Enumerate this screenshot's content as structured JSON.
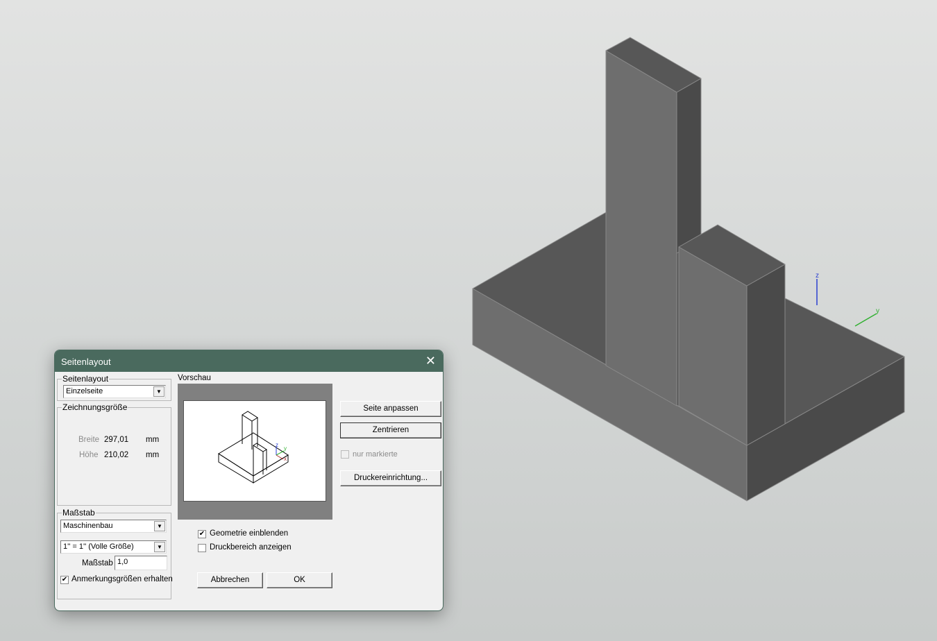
{
  "dialog": {
    "title": "Seitenlayout",
    "layout_group": {
      "label": "Seitenlayout",
      "selected": "Einzelseite"
    },
    "size_group": {
      "label": "Zeichnungsgröße",
      "width_label": "Breite",
      "width_value": "297,01",
      "height_label": "Höhe",
      "height_value": "210,02",
      "unit": "mm"
    },
    "scale_group": {
      "label": "Maßstab",
      "standard": "Maschinenbau",
      "ratio": "1'' = 1'' (Volle Größe)",
      "scale_label": "Maßstab",
      "scale_value": "1,0",
      "keep_annotation_label": "Anmerkungsgrößen erhalten",
      "keep_annotation_checked": true
    },
    "preview": {
      "label": "Vorschau"
    },
    "buttons": {
      "fit": "Seite anpassen",
      "center": "Zentrieren",
      "printer_setup": "Druckereinrichtung...",
      "cancel": "Abbrechen",
      "ok": "OK"
    },
    "only_selected": {
      "label": "nur markierte",
      "checked": false
    },
    "show_geometry": {
      "label": "Geometrie einblenden",
      "checked": true
    },
    "show_print_area": {
      "label": "Druckbereich anzeigen",
      "checked": false
    }
  },
  "viewport": {
    "axes": {
      "z": "z",
      "y": "y",
      "x": "x"
    },
    "colors": {
      "top": "#575757",
      "left": "#6e6e6e",
      "right": "#4a4a4a"
    }
  }
}
